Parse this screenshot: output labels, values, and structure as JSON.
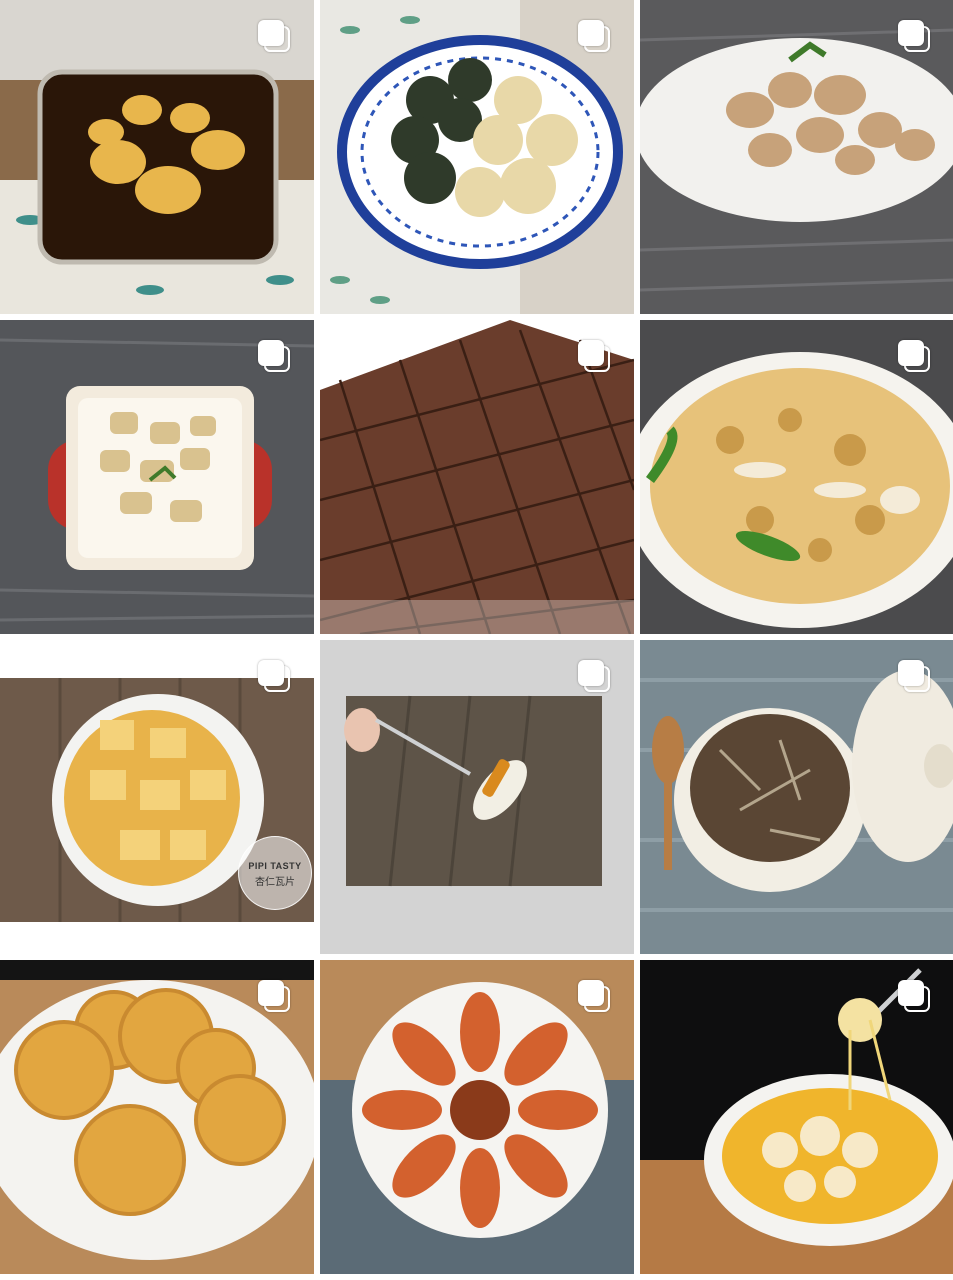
{
  "gallery": {
    "posts": [
      {
        "name": "post-tea-eggs",
        "multiple": true
      },
      {
        "name": "post-rice-balls",
        "multiple": true
      },
      {
        "name": "post-mushrooms",
        "multiple": true
      },
      {
        "name": "post-bamboo-dish",
        "multiple": true
      },
      {
        "name": "post-chocolate-cake",
        "multiple": true
      },
      {
        "name": "post-seafood-pancake",
        "multiple": true
      },
      {
        "name": "post-almond-crisps",
        "multiple": true
      },
      {
        "name": "post-dessert-spoon",
        "multiple": true
      },
      {
        "name": "post-clay-pot",
        "multiple": true
      },
      {
        "name": "post-egg-tarts",
        "multiple": true
      },
      {
        "name": "post-garlic-shrimp",
        "multiple": true
      },
      {
        "name": "post-cheese-gratin",
        "multiple": true
      }
    ],
    "watermark": {
      "line1": "PIPI TASTY",
      "line2": "杏仁瓦片"
    },
    "icon": "multiple-photos-icon"
  }
}
